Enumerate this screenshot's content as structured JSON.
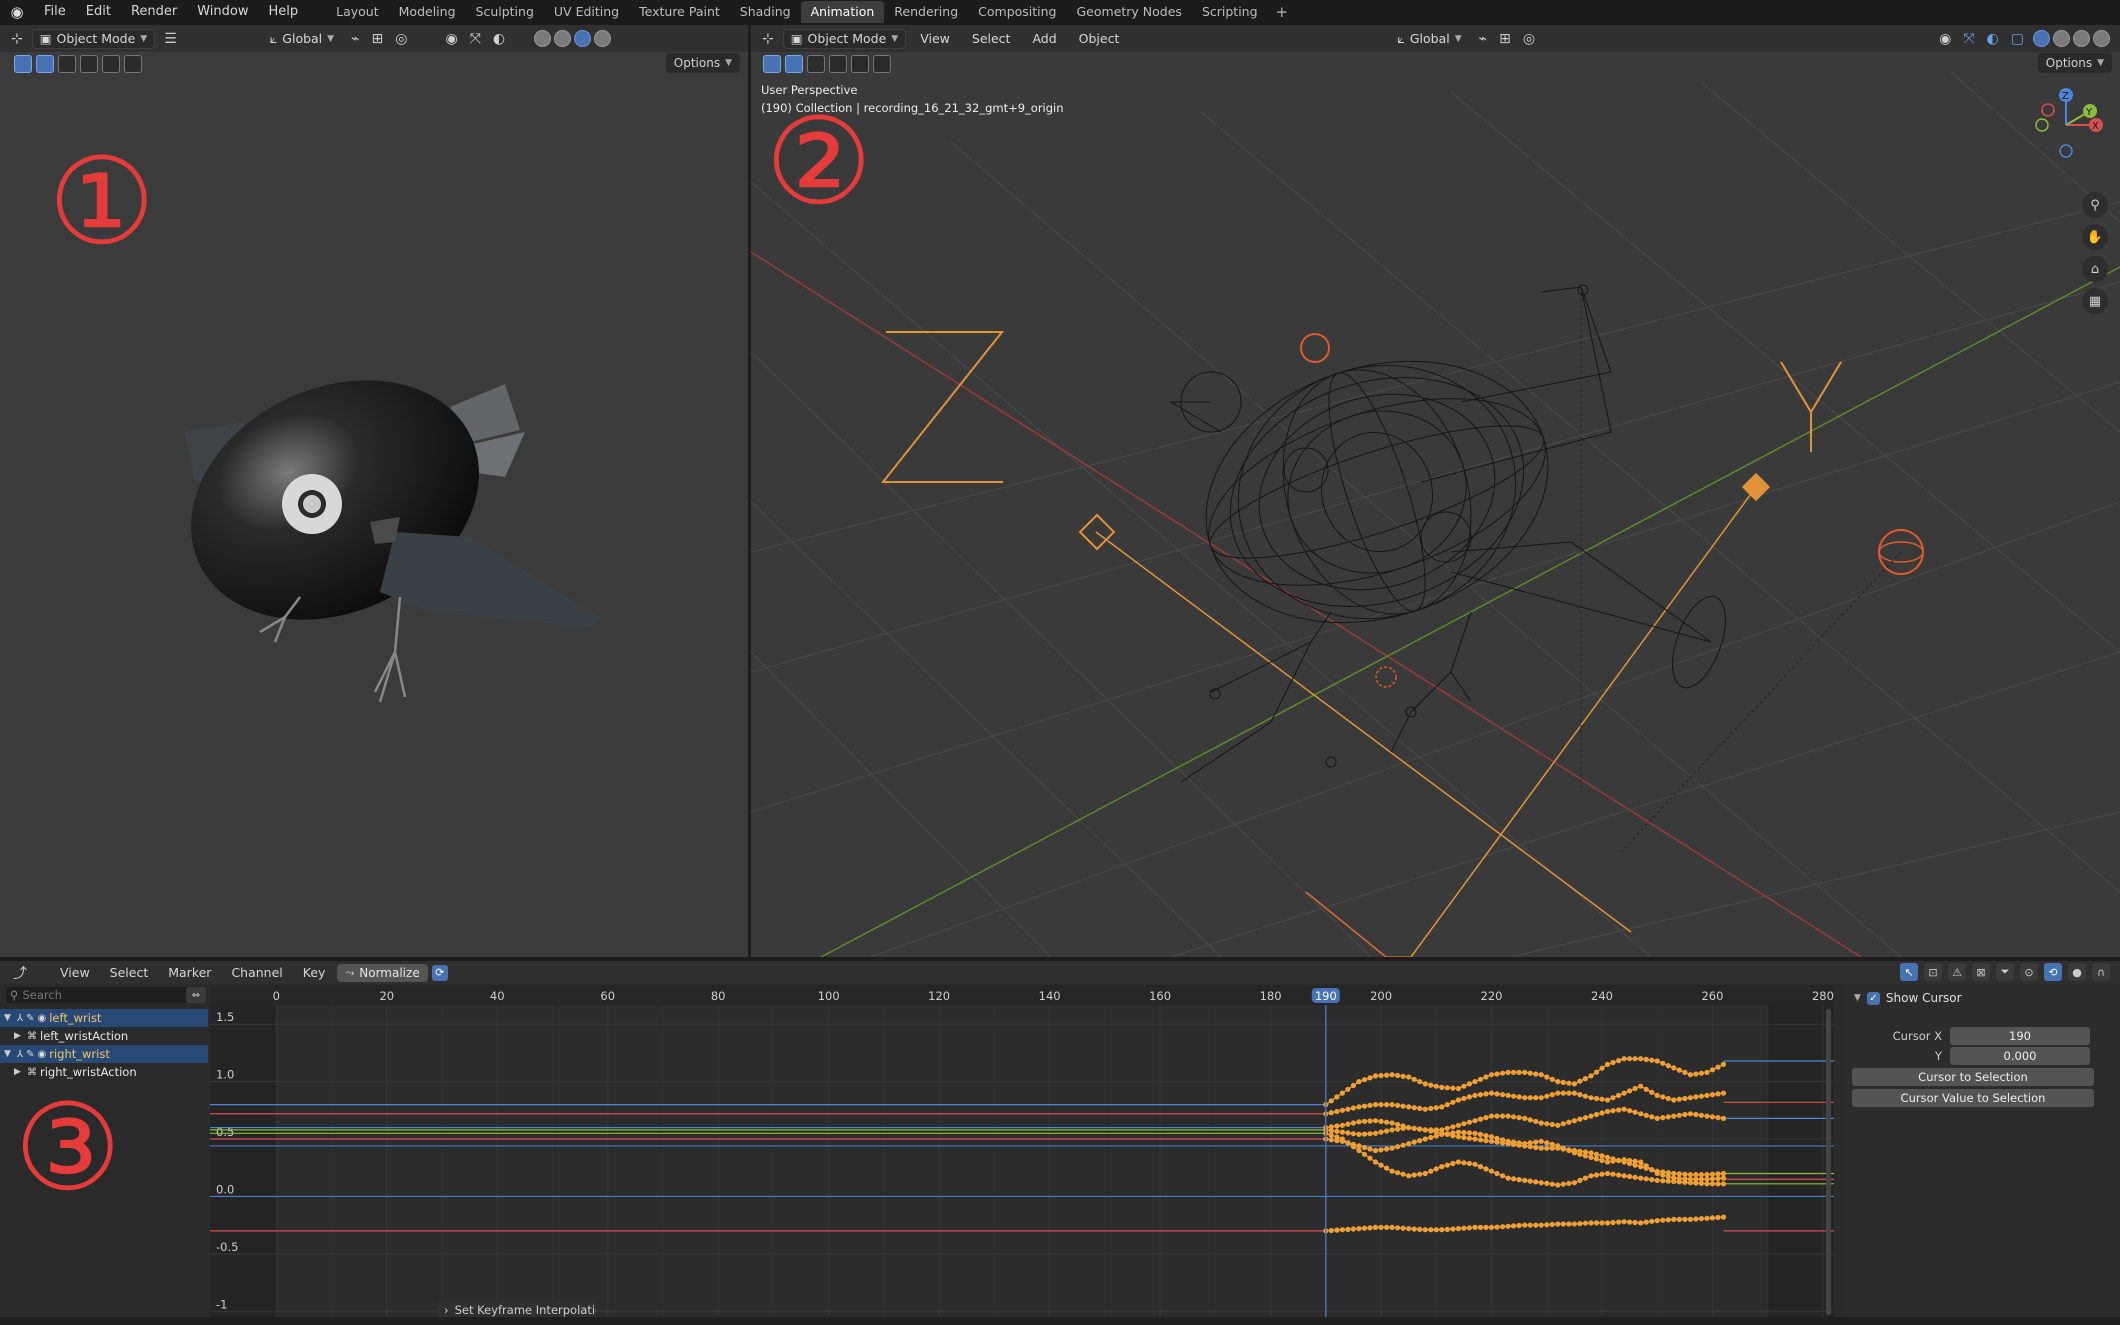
{
  "topbar": {
    "menus": [
      "File",
      "Edit",
      "Render",
      "Window",
      "Help"
    ],
    "workspaces": [
      "Layout",
      "Modeling",
      "Sculpting",
      "UV Editing",
      "Texture Paint",
      "Shading",
      "Animation",
      "Rendering",
      "Compositing",
      "Geometry Nodes",
      "Scripting"
    ],
    "active_workspace": "Animation",
    "add_tab": "+"
  },
  "viewport_left": {
    "mode": "Object Mode",
    "orientation": "Global",
    "options": "Options",
    "marker": "①"
  },
  "viewport_right": {
    "mode": "Object Mode",
    "menus": [
      "View",
      "Select",
      "Add",
      "Object"
    ],
    "orientation": "Global",
    "options": "Options",
    "info_line1": "User Perspective",
    "info_line2": "(190) Collection | recording_16_21_32_gmt+9_origin",
    "marker": "②",
    "gizmo": {
      "x": "X",
      "y": "Y",
      "z": "Z"
    }
  },
  "graph_editor": {
    "menus": [
      "View",
      "Select",
      "Marker",
      "Channel",
      "Key"
    ],
    "normalize": "Normalize",
    "marker": "③",
    "search_placeholder": "Search",
    "channels": [
      {
        "name": "left_wrist",
        "type": "object"
      },
      {
        "name": "left_wristAction",
        "type": "action"
      },
      {
        "name": "right_wrist",
        "type": "object"
      },
      {
        "name": "right_wristAction",
        "type": "action"
      }
    ],
    "frame_ticks": [
      "0",
      "20",
      "40",
      "60",
      "80",
      "100",
      "120",
      "140",
      "160",
      "180",
      "200",
      "220",
      "240",
      "260",
      "280"
    ],
    "current_frame": "190",
    "value_ticks": [
      "1.5",
      "1.0",
      "0.5",
      "0.0",
      "-0.5",
      "-1"
    ],
    "sidebar": {
      "show_cursor": "Show Cursor",
      "cursor_x_label": "Cursor X",
      "cursor_x": "190",
      "y_label": "Y",
      "y_value": "0.000",
      "btn_cursor_to_selection": "Cursor to Selection",
      "btn_cursor_value_to_selection": "Cursor Value to Selection"
    },
    "operator_panel": "Set Keyframe Interpolatio",
    "colors": {
      "keyframe": "#f0a032",
      "current_frame": "#4772b3",
      "x_channel": "#d84f4f",
      "y_channel": "#8cbd3d",
      "z_channel": "#4d86d8"
    }
  },
  "chart_data": {
    "type": "line",
    "xlabel": "",
    "ylabel": "",
    "xlim": [
      -12,
      282
    ],
    "ylim": [
      -1.05,
      1.65
    ],
    "key_range": [
      190,
      262
    ],
    "series": [
      {
        "color": "#4d86d8",
        "flat": 1.18,
        "start": 0.8,
        "values": [
          0.8,
          0.9,
          1.0,
          1.05,
          1.06,
          1.04,
          0.98,
          0.95,
          0.94,
          1.0,
          1.06,
          1.08,
          1.08,
          1.06,
          1.0,
          0.98,
          1.05,
          1.15,
          1.2,
          1.2,
          1.18,
          1.12,
          1.06,
          1.08,
          1.15
        ]
      },
      {
        "color": "#d84f4f",
        "flat": 0.82,
        "start": 0.72,
        "values": [
          0.72,
          0.75,
          0.78,
          0.8,
          0.8,
          0.78,
          0.76,
          0.78,
          0.84,
          0.88,
          0.9,
          0.88,
          0.86,
          0.86,
          0.9,
          0.9,
          0.86,
          0.84,
          0.9,
          0.96,
          0.88,
          0.84,
          0.86,
          0.88,
          0.9
        ]
      },
      {
        "color": "#4d86d8",
        "flat": 0.68,
        "start": 0.6,
        "values": [
          0.6,
          0.62,
          0.65,
          0.66,
          0.64,
          0.6,
          0.58,
          0.58,
          0.62,
          0.66,
          0.7,
          0.7,
          0.68,
          0.64,
          0.62,
          0.66,
          0.7,
          0.74,
          0.76,
          0.72,
          0.68,
          0.7,
          0.72,
          0.7,
          0.68
        ]
      },
      {
        "color": "#8cbd3d",
        "flat": 0.2,
        "start": 0.58,
        "values": [
          0.58,
          0.56,
          0.54,
          0.55,
          0.58,
          0.6,
          0.58,
          0.55,
          0.52,
          0.5,
          0.48,
          0.46,
          0.44,
          0.42,
          0.42,
          0.4,
          0.38,
          0.34,
          0.3,
          0.26,
          0.22,
          0.2,
          0.19,
          0.19,
          0.2
        ]
      },
      {
        "color": "#d84f4f",
        "flat": 0.15,
        "start": 0.5,
        "values": [
          0.5,
          0.48,
          0.44,
          0.4,
          0.42,
          0.46,
          0.5,
          0.54,
          0.56,
          0.55,
          0.52,
          0.48,
          0.46,
          0.48,
          0.44,
          0.38,
          0.34,
          0.3,
          0.32,
          0.3,
          0.2,
          0.16,
          0.15,
          0.15,
          0.16
        ]
      },
      {
        "color": "#8cbd3d",
        "flat": 0.11,
        "start": 0.55,
        "values": [
          0.55,
          0.5,
          0.4,
          0.3,
          0.22,
          0.18,
          0.2,
          0.26,
          0.3,
          0.28,
          0.22,
          0.16,
          0.14,
          0.12,
          0.1,
          0.12,
          0.18,
          0.2,
          0.18,
          0.16,
          0.14,
          0.13,
          0.12,
          0.11,
          0.11
        ]
      },
      {
        "color": "#d84f4f",
        "flat": -0.3,
        "start": -0.3,
        "values": [
          -0.3,
          -0.29,
          -0.28,
          -0.27,
          -0.27,
          -0.28,
          -0.29,
          -0.29,
          -0.28,
          -0.27,
          -0.27,
          -0.26,
          -0.25,
          -0.25,
          -0.24,
          -0.24,
          -0.23,
          -0.23,
          -0.22,
          -0.23,
          -0.21,
          -0.2,
          -0.2,
          -0.19,
          -0.18
        ]
      }
    ],
    "flat_lines": [
      {
        "color": "#4d86d8",
        "value": 0.0
      },
      {
        "color": "#4d86d8",
        "value": 0.44
      }
    ]
  }
}
